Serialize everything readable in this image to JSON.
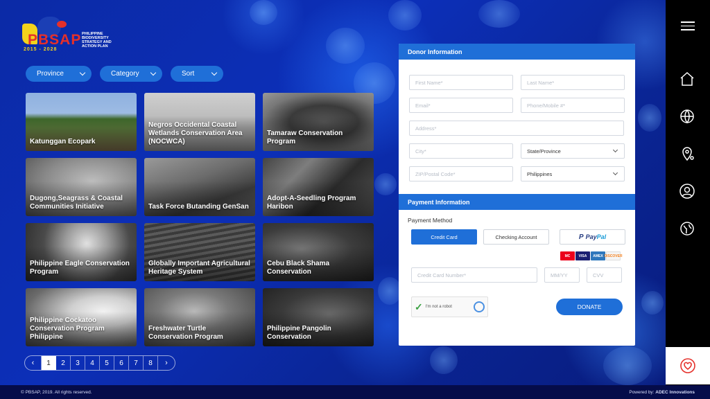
{
  "logo": {
    "brand": "PBSAP",
    "years": "2015 - 2028",
    "tagline": "Philippine Biodiversity Strategy and Action Plan"
  },
  "filters": [
    {
      "label": "Province"
    },
    {
      "label": "Category"
    },
    {
      "label": "Sort"
    }
  ],
  "programs": [
    {
      "title": "Katunggan Ecopark"
    },
    {
      "title": "Negros Occidental Coastal Wetlands Conservation Area (NOCWCA)"
    },
    {
      "title": "Tamaraw Conservation Program"
    },
    {
      "title": "Dugong,Seagrass & Coastal Communities Initiative"
    },
    {
      "title": "Task Force Butanding GenSan"
    },
    {
      "title": "Adopt-A-Seedling Program Haribon"
    },
    {
      "title": "Philippine Eagle Conservation Program"
    },
    {
      "title": "Globally Important Agricultural Heritage System"
    },
    {
      "title": "Cebu Black Shama Conservation"
    },
    {
      "title": "Philippine Cockatoo Conservation Program Philippine"
    },
    {
      "title": "Freshwater Turtle Conservation Program"
    },
    {
      "title": "Philippine Pangolin Conservation"
    }
  ],
  "pagination": {
    "prev": "‹",
    "next": "›",
    "pages": [
      "1",
      "2",
      "3",
      "4",
      "5",
      "6",
      "7",
      "8"
    ],
    "current": "1"
  },
  "donor": {
    "heading": "Donor Information",
    "first_name_placeholder": "First Name*",
    "last_name_placeholder": "Last Name*",
    "email_placeholder": "Email*",
    "phone_placeholder": "Phone/Mobile #*",
    "address_placeholder": "Address*",
    "city_placeholder": "City*",
    "state_value": "State/Province",
    "zip_placeholder": "ZIP/Postal Code*",
    "country_value": "Philippines"
  },
  "payment": {
    "heading": "Payment Information",
    "method_label": "Payment Method",
    "credit_card": "Credit Card",
    "checking": "Checking Account",
    "paypal_p1": "Pay",
    "paypal_p2": "Pal",
    "card_logos": [
      "MC",
      "VISA",
      "AMEX",
      "DISCOVER"
    ],
    "card_number_placeholder": "Credit Card Number*",
    "expiry_placeholder": "MM/YY",
    "cvv_placeholder": "CVV",
    "captcha_label": "I'm not a robot",
    "donate": "DONATE"
  },
  "sidebar": {
    "icons": [
      "menu-icon",
      "home-icon",
      "globe-icon",
      "map-pin-icon",
      "user-icon",
      "earth-heart-icon",
      "heart-icon"
    ]
  },
  "footer": {
    "copyright": "© PBSAP, 2019. All rights reserved.",
    "powered_prefix": "Powered by: ",
    "powered_by": "ADEC Innovations"
  },
  "colors": {
    "accent": "#1f6fd8",
    "sidebar": "#000000",
    "footer": "#050c4a"
  }
}
